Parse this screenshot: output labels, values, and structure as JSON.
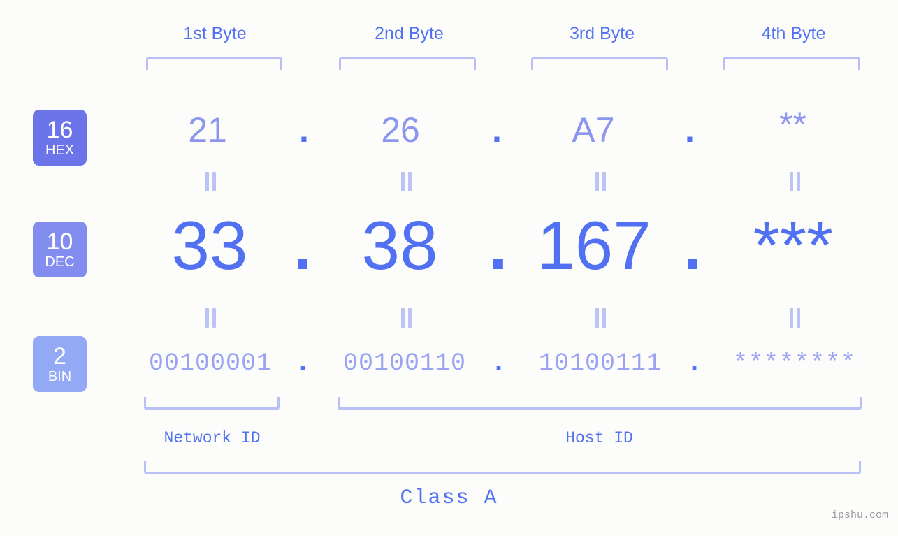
{
  "background_color": "#fcfdfa",
  "accent_color": "#5271f2",
  "bracket_color": "#b8c0f5",
  "byte_headers": [
    {
      "label": "1st Byte"
    },
    {
      "label": "2nd Byte"
    },
    {
      "label": "3rd Byte"
    },
    {
      "label": "4th Byte"
    }
  ],
  "bases": [
    {
      "number": "16",
      "name": "HEX",
      "color": "#6b74e8"
    },
    {
      "number": "10",
      "name": "DEC",
      "color": "#838df0"
    },
    {
      "number": "2",
      "name": "BIN",
      "color": "#93a9f5"
    }
  ],
  "rows": {
    "hex": {
      "base_number": "16",
      "base_name": "HEX",
      "values": [
        "21",
        "26",
        "A7",
        "**"
      ],
      "separator": "."
    },
    "dec": {
      "base_number": "10",
      "base_name": "DEC",
      "values": [
        "33",
        "38",
        "167",
        "***"
      ],
      "separator": "."
    },
    "bin": {
      "base_number": "2",
      "base_name": "BIN",
      "values": [
        "00100001",
        "00100110",
        "10100111",
        "********"
      ],
      "separator": "."
    }
  },
  "equality_symbol": "=",
  "id_sections": [
    {
      "label": "Network ID"
    },
    {
      "label": "Host ID"
    }
  ],
  "class_label": "Class A",
  "watermark": "ipshu.com"
}
